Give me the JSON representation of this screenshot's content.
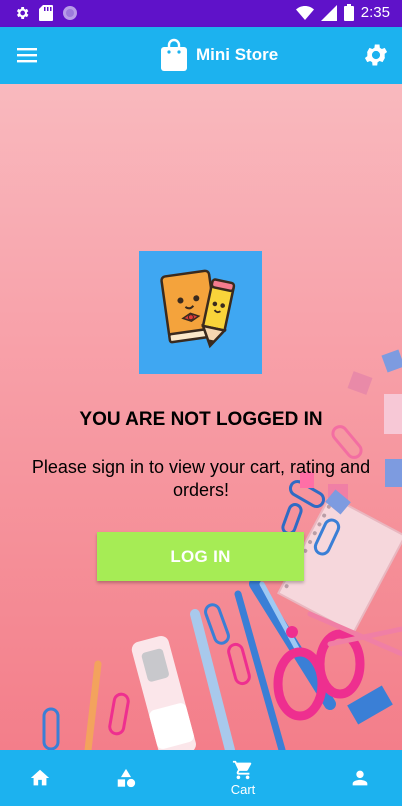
{
  "status_bar": {
    "time": "2:35",
    "left_icons": [
      "gear-icon",
      "sd-card-icon",
      "circle-icon"
    ],
    "right_icons": [
      "wifi-icon",
      "signal-icon",
      "battery-icon"
    ]
  },
  "app_bar": {
    "title": "Mini Store",
    "menu_icon": "menu-icon",
    "logo_icon": "shopping-bag-icon",
    "settings_icon": "gear-icon"
  },
  "main": {
    "logo_image": "book-and-pencil-mascot",
    "heading": "YOU ARE NOT LOGGED IN",
    "message": "Please sign in to view your cart, rating and orders!",
    "login_button": "LOG IN"
  },
  "bottom_nav": {
    "items": [
      {
        "icon": "home-icon",
        "label": ""
      },
      {
        "icon": "categories-icon",
        "label": ""
      },
      {
        "icon": "cart-icon",
        "label": "Cart"
      },
      {
        "icon": "profile-icon",
        "label": ""
      }
    ]
  },
  "colors": {
    "status_bar": "#5f12c9",
    "primary": "#1cb2ef",
    "login_button": "#a6ec55",
    "background": "#f9a4ab",
    "logo_background": "#3fa7f2"
  }
}
